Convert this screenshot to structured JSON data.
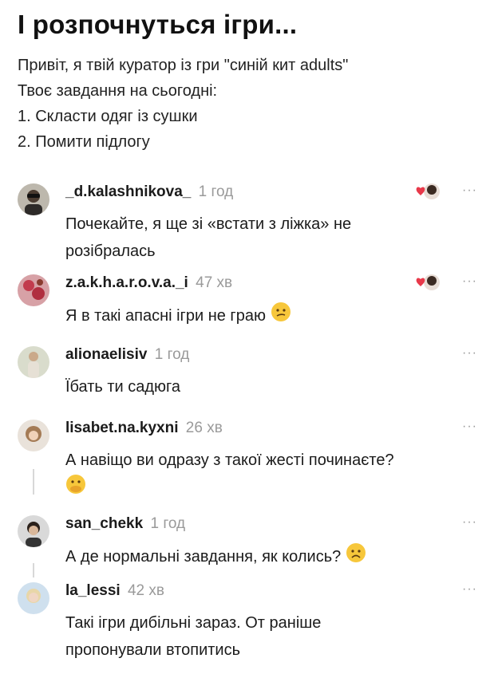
{
  "post": {
    "title": "І розпочнуться ігри...",
    "lines": [
      "Привіт, я твій куратор із гри \"синій кит adults\"",
      "Твоє завдання на сьогодні:",
      "1. Скласти одяг із сушки",
      "2. Помити підлогу"
    ]
  },
  "more_label": "···",
  "comments": [
    {
      "user": "_d.kalashnikova_",
      "time": "1 год",
      "text1": "Почекайте, я ще зі «встати з ліжка» не",
      "text2": "розібралась"
    },
    {
      "user": "z.a.k.h.a.r.o.v.a._i",
      "time": "47 хв",
      "text1": "Я в такі апасні ігри не граю",
      "emoji": "confused-face-icon"
    },
    {
      "user": "alionaelisiv",
      "time": "1 год",
      "text1": "Їбать ти садюга"
    },
    {
      "user": "lisabet.na.kyxni",
      "time": "26 хв",
      "text1": "А навіщо ви одразу з такої жесті починаєте?",
      "emoji": "hand-over-mouth-icon"
    },
    {
      "user": "san_chekk",
      "time": "1 год",
      "text1": "А де нормальні завдання, як колись?",
      "emoji": "frowning-face-icon"
    },
    {
      "user": "la_lessi",
      "time": "42 хв",
      "text1": "Такі ігри дибільні зараз. От раніше",
      "text2": "пропонували втопитись"
    }
  ]
}
